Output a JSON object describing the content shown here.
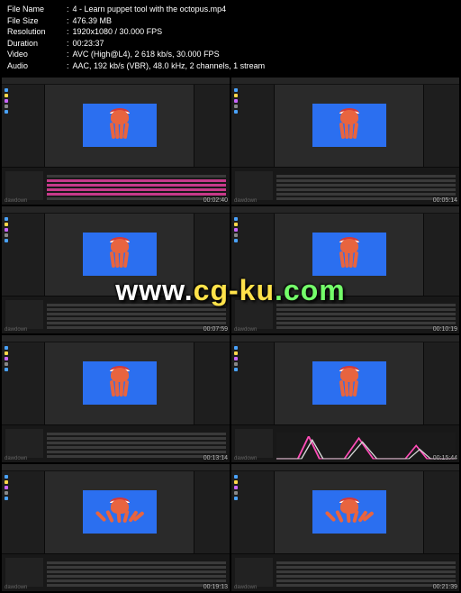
{
  "header": {
    "rows": [
      {
        "label": "File Name",
        "value": "4 - Learn puppet tool with the octopus.mp4"
      },
      {
        "label": "File Size",
        "value": "476.39 MB"
      },
      {
        "label": "Resolution",
        "value": "1920x1080 / 30.000 FPS"
      },
      {
        "label": "Duration",
        "value": "00:23:37"
      },
      {
        "label": "Video",
        "value": "AVC (High@L4), 2 618 kb/s, 30.000 FPS"
      },
      {
        "label": "Audio",
        "value": "AAC, 192 kb/s (VBR), 48.0 kHz, 2 channels, 1 stream"
      }
    ]
  },
  "watermark": {
    "part1": "www.",
    "part2": "cg-ku",
    "part3": ".com"
  },
  "download_logo": "dawdown",
  "thumbnails": [
    {
      "timestamp": "00:02:40",
      "variant": "normal",
      "timeline": "pink"
    },
    {
      "timestamp": "00:05:14",
      "variant": "normal",
      "timeline": "plain"
    },
    {
      "timestamp": "00:07:59",
      "variant": "normal",
      "timeline": "plain"
    },
    {
      "timestamp": "00:10:19",
      "variant": "normal",
      "timeline": "plain"
    },
    {
      "timestamp": "00:13:14",
      "variant": "normal",
      "timeline": "plain"
    },
    {
      "timestamp": "00:15:44",
      "variant": "normal",
      "timeline": "graph"
    },
    {
      "timestamp": "00:19:13",
      "variant": "wide",
      "timeline": "plain"
    },
    {
      "timestamp": "00:21:39",
      "variant": "wide",
      "timeline": "plain"
    }
  ]
}
